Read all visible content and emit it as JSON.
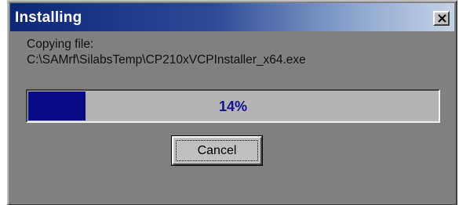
{
  "window": {
    "title": "Installing",
    "close_icon": "close-icon"
  },
  "status": {
    "label": "Copying file:",
    "file_path": "C:\\SAMrf\\SilabsTemp\\CP210xVCPInstaller_x64.exe"
  },
  "progress": {
    "percent": 14,
    "text": "14%"
  },
  "buttons": {
    "cancel_label": "Cancel"
  },
  "colors": {
    "progress_fill": "#0a0a84",
    "progress_text": "#12128f",
    "title_bar_start": "#0b2877",
    "window_face": "#808080"
  }
}
